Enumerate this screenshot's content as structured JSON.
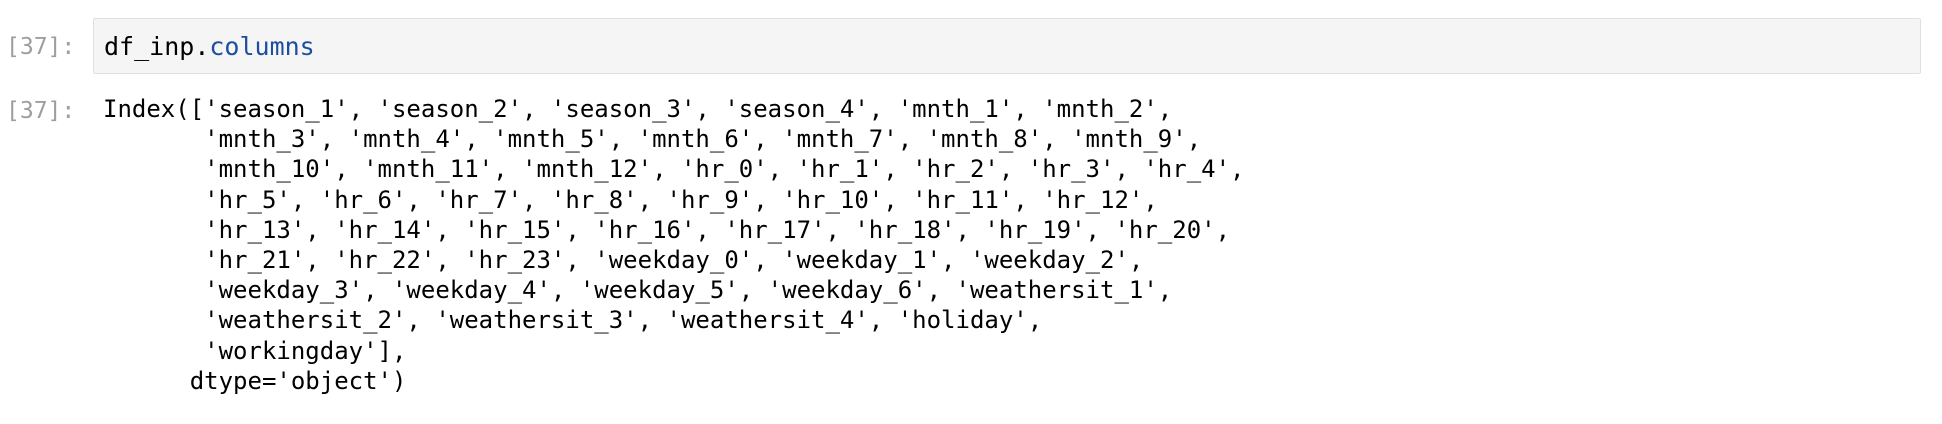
{
  "input_cell": {
    "prompt": "[37]:",
    "code": {
      "object": "df_inp",
      "dot": ".",
      "attribute": "columns"
    }
  },
  "output_cell": {
    "prompt": "[37]:",
    "text": "Index(['season_1', 'season_2', 'season_3', 'season_4', 'mnth_1', 'mnth_2',\n       'mnth_3', 'mnth_4', 'mnth_5', 'mnth_6', 'mnth_7', 'mnth_8', 'mnth_9',\n       'mnth_10', 'mnth_11', 'mnth_12', 'hr_0', 'hr_1', 'hr_2', 'hr_3', 'hr_4',\n       'hr_5', 'hr_6', 'hr_7', 'hr_8', 'hr_9', 'hr_10', 'hr_11', 'hr_12',\n       'hr_13', 'hr_14', 'hr_15', 'hr_16', 'hr_17', 'hr_18', 'hr_19', 'hr_20',\n       'hr_21', 'hr_22', 'hr_23', 'weekday_0', 'weekday_1', 'weekday_2',\n       'weekday_3', 'weekday_4', 'weekday_5', 'weekday_6', 'weathersit_1',\n       'weathersit_2', 'weathersit_3', 'weathersit_4', 'holiday',\n       'workingday'],\n      dtype='object')"
  },
  "colors": {
    "prompt": "#9e9e9e",
    "input_background": "#f5f5f5",
    "input_border": "#e0e0e0",
    "attribute_token": "#1d4e9e",
    "text": "#000000"
  }
}
